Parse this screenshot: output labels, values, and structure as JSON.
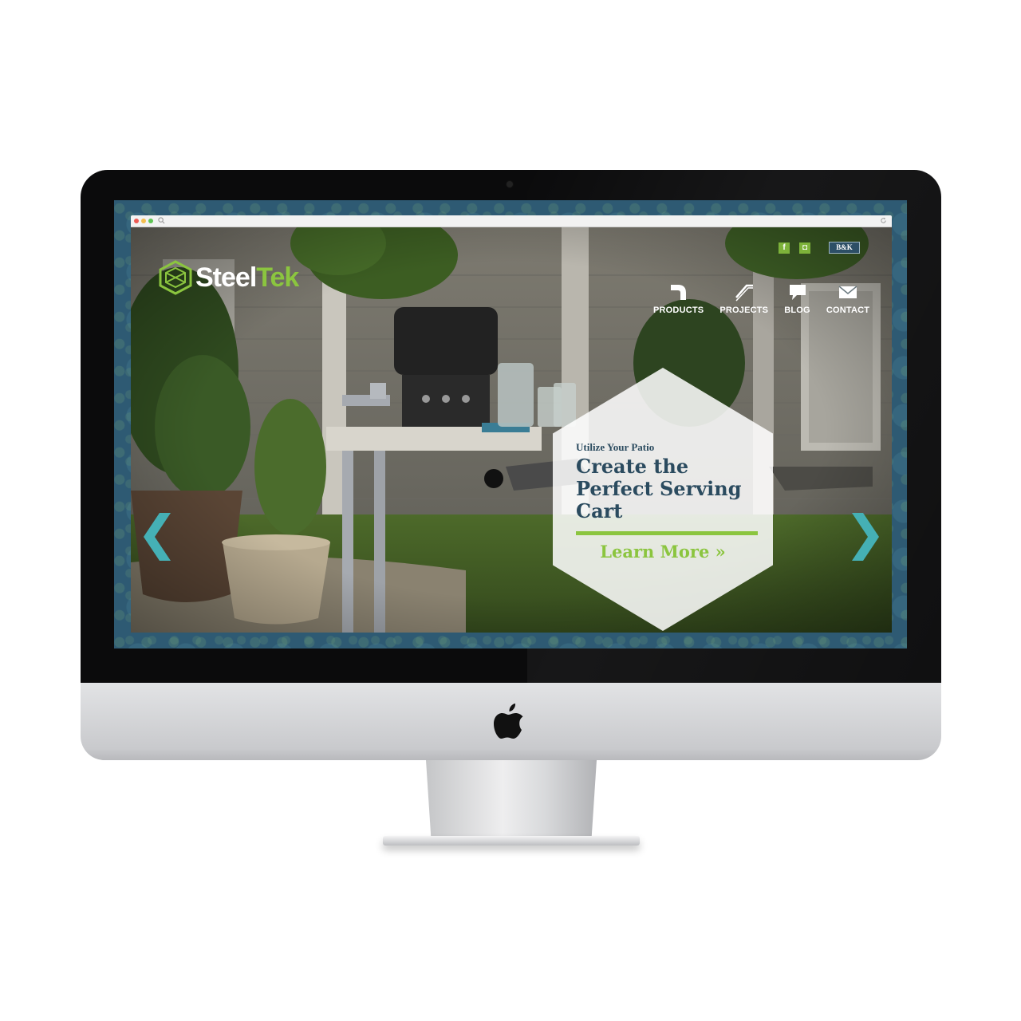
{
  "site": {
    "logo_steel": "Steel",
    "logo_tek": "Tek",
    "social": {
      "facebook_label": "f",
      "instagram_label": "◘",
      "partner_label": "B&K"
    },
    "nav": [
      {
        "label": "PRODUCTS",
        "icon": "pipe-elbow-icon"
      },
      {
        "label": "PROJECTS",
        "icon": "pipe-angle-icon"
      },
      {
        "label": "BLOG",
        "icon": "speech-bubble-icon"
      },
      {
        "label": "CONTACT",
        "icon": "envelope-icon"
      }
    ],
    "hero": {
      "eyebrow": "Utilize Your Patio",
      "title": "Create the Perfect Serving Cart",
      "cta": "Learn More »"
    }
  },
  "colors": {
    "accent_green": "#8bc53f",
    "navy": "#2b4b5f",
    "teal_arrow": "#45b0b5",
    "frame_blue": "#2e5a73"
  }
}
